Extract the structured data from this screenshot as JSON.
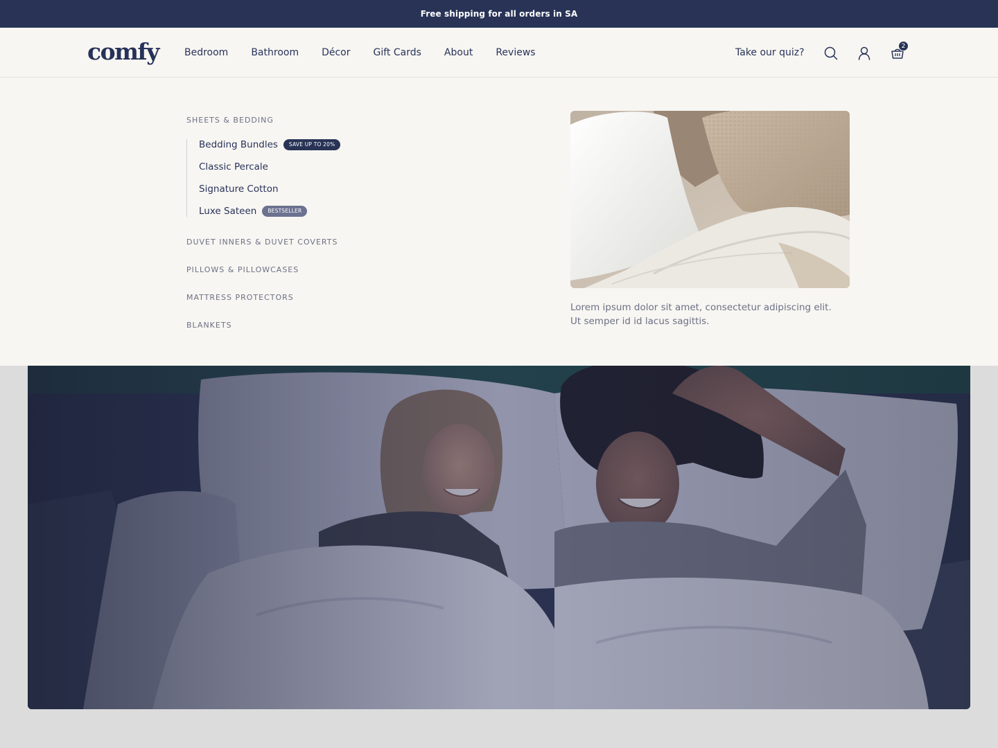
{
  "announcement": "Free shipping for all orders in SA",
  "header": {
    "logo": "comfy",
    "nav": [
      {
        "label": "Bedroom",
        "active": true
      },
      {
        "label": "Bathroom",
        "active": false
      },
      {
        "label": "Décor",
        "active": false
      },
      {
        "label": "Gift Cards",
        "active": false
      },
      {
        "label": "About",
        "active": false
      },
      {
        "label": "Reviews",
        "active": false
      }
    ],
    "quiz_label": "Take our quiz?",
    "icons": [
      "search-icon",
      "account-icon",
      "cart-icon"
    ],
    "cart_count": "2"
  },
  "mega_menu": {
    "sections": [
      {
        "title": "SHEETS & BEDDING",
        "items": [
          {
            "label": "Bedding Bundles",
            "badge": "SAVE UP TO 20%"
          },
          {
            "label": "Classic Percale",
            "badge": ""
          },
          {
            "label": "Signature Cotton",
            "badge": ""
          },
          {
            "label": "Luxe Sateen",
            "badge": "BESTSELLER"
          }
        ]
      },
      {
        "title": "DUVET INNERS & DUVET COVERTS"
      },
      {
        "title": "PILLOWS & PILLOWCASES"
      },
      {
        "title": "MATTRESS PROTECTORS"
      },
      {
        "title": "BLANKETS"
      }
    ],
    "promo": {
      "text_line1": "Lorem ipsum dolor sit amet, consectetur adipiscing elit.",
      "text_line2": "Ut semper id id lacus sagittis."
    }
  },
  "colors": {
    "navy": "#283356",
    "text": "#27325a",
    "muted": "#6b7085",
    "cream": "#f8f6f2",
    "page_bg": "#dcdcdc"
  }
}
